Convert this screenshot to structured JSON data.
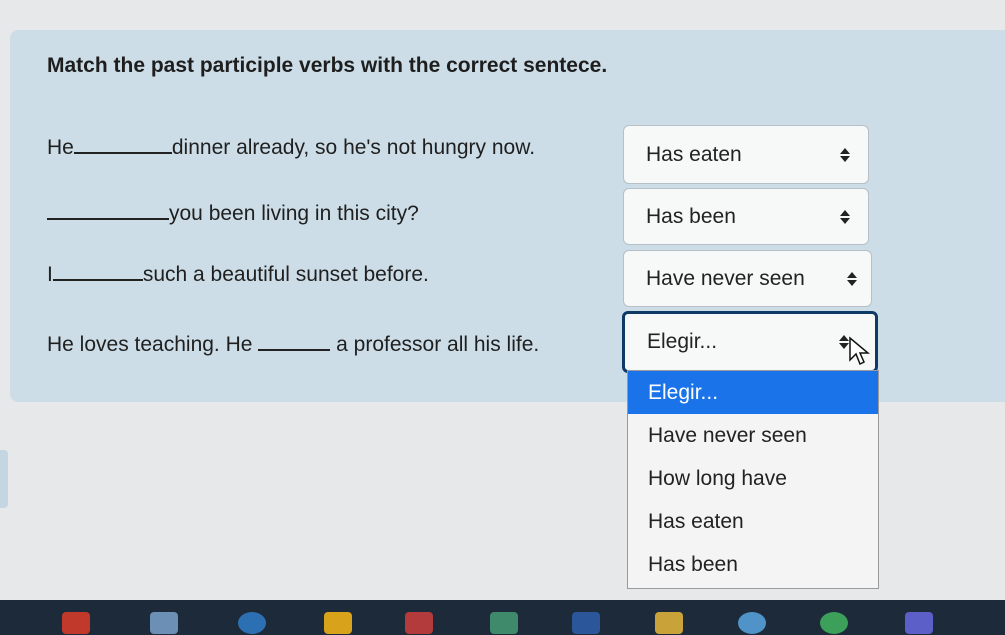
{
  "instruction": "Match the past participle verbs with the correct sentece.",
  "questions": [
    {
      "before": "He",
      "after": "dinner already, so he's not hungry now.",
      "answer": "Has eaten"
    },
    {
      "before": "",
      "after": "you been living in this city?",
      "answer": "Has been"
    },
    {
      "before": "I",
      "after": "such a beautiful sunset before.",
      "answer": "Have never seen"
    },
    {
      "before": "He loves teaching. He",
      "after": "a professor all his life.",
      "answer": "Elegir..."
    }
  ],
  "dropdown": {
    "options": [
      "Elegir...",
      "Have never seen",
      "How long have",
      "Has eaten",
      "Has been"
    ],
    "selected_index": 0
  },
  "icons": [
    "chevron-updown-icon",
    "mouse-pointer-icon"
  ],
  "taskbar_icons": [
    "app1-icon",
    "app2-icon",
    "app3-icon",
    "app4-icon",
    "app5-icon",
    "app6-icon",
    "word-icon",
    "app8-icon",
    "app9-icon",
    "chrome-icon",
    "teams-icon"
  ]
}
